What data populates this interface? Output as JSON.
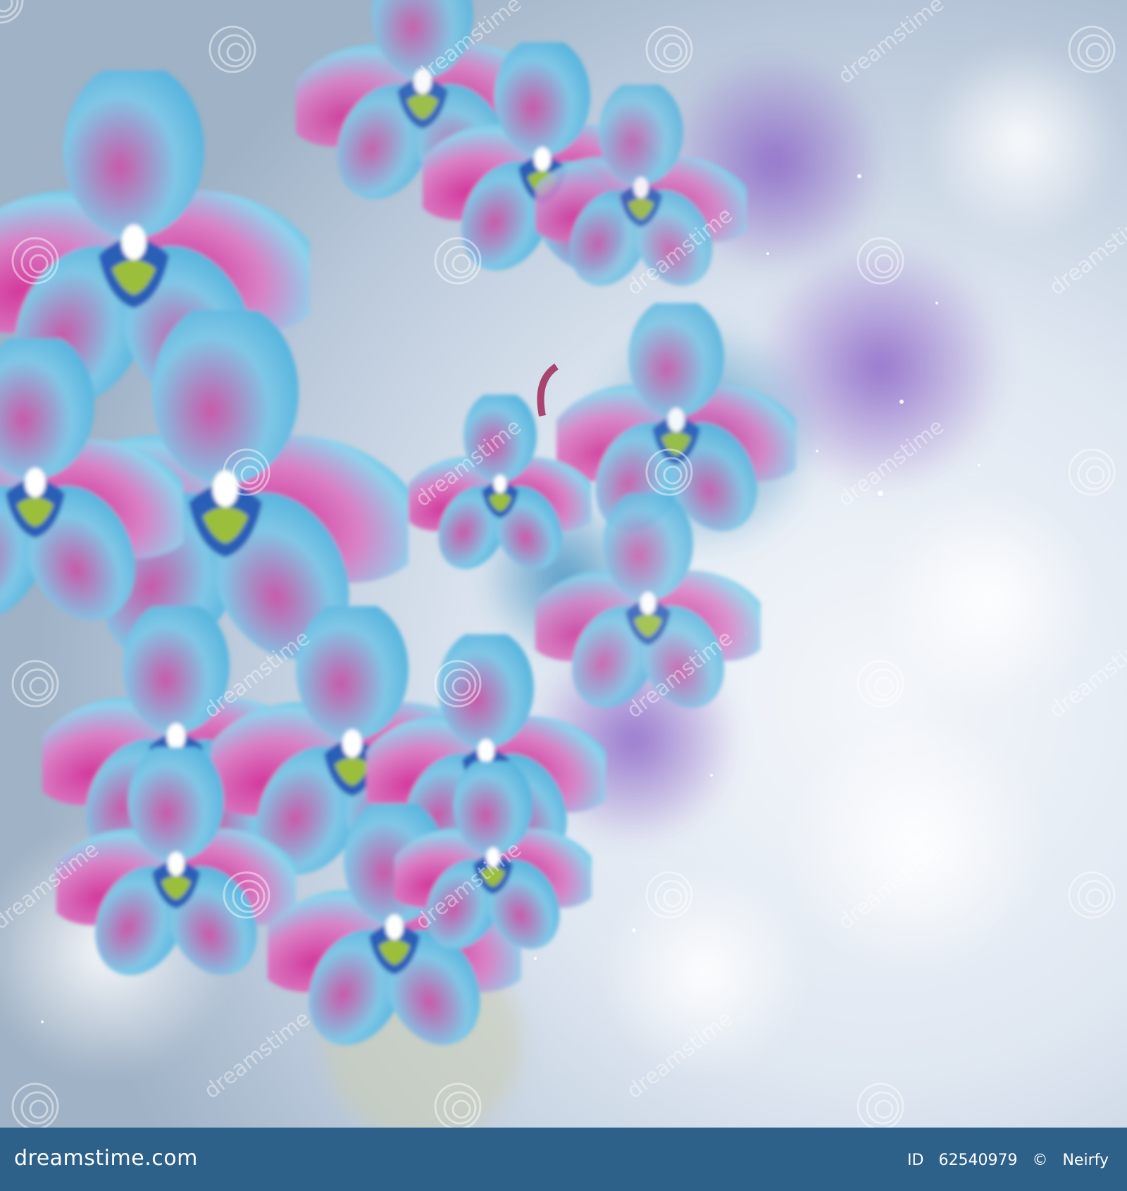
{
  "footer": {
    "brand": "dreamstime.com",
    "id_label": "ID",
    "id_number": "62540979",
    "copyright_symbol": "©",
    "author": "Neirfy"
  },
  "watermark": {
    "text": "dreamstime",
    "icon": "spiral-logo-icon"
  },
  "colors": {
    "footer_bg": "#2d6189",
    "petal_blue": "#5ec3e6",
    "petal_pink": "#d64fa8",
    "bokeh_purple": "#8a6cc4",
    "bokeh_white": "#eef2f7"
  }
}
